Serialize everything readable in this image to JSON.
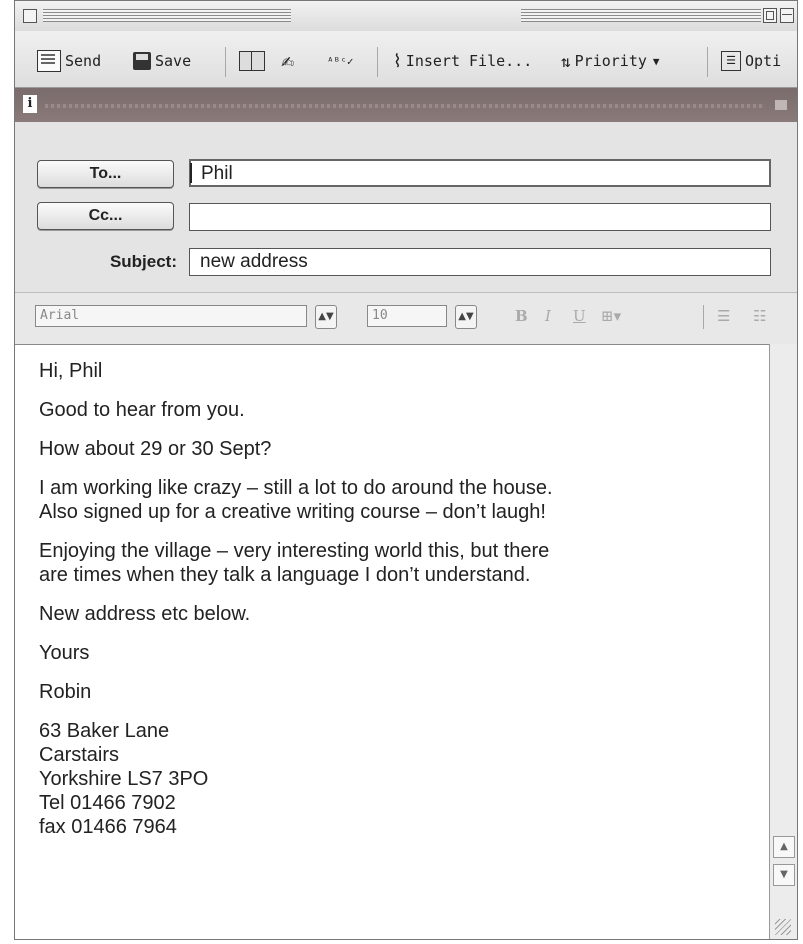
{
  "toolbar": {
    "send_label": "Send",
    "save_label": "Save",
    "insert_file_label": "Insert File...",
    "priority_label": "Priority",
    "options_label": "Opti"
  },
  "header": {
    "to_button": "To...",
    "cc_button": "Cc...",
    "subject_label": "Subject:",
    "to_value": "Phil",
    "cc_value": "",
    "subject_value": "new address"
  },
  "format": {
    "font_name": "Arial",
    "font_size": "10",
    "bold": "B",
    "italic": "I",
    "underline": "U"
  },
  "body": {
    "greeting": "Hi, Phil",
    "p1": "Good to hear from you.",
    "p2": "How about 29 or 30 Sept?",
    "p3_line1": "I am working like crazy – still a lot to do around the house.",
    "p3_line2": "Also signed up for a creative writing course –  don’t laugh!",
    "p4_line1": "Enjoying the village – very interesting world this, but there",
    "p4_line2": "are times when they talk a language I don’t understand.",
    "p5": "New address etc below.",
    "closing": "Yours",
    "signature": "Robin",
    "address_line1": "63 Baker Lane",
    "address_line2": "Carstairs",
    "address_line3": "Yorkshire LS7 3PO",
    "tel": "Tel 01466 7902",
    "fax": "fax 01466 7964"
  }
}
